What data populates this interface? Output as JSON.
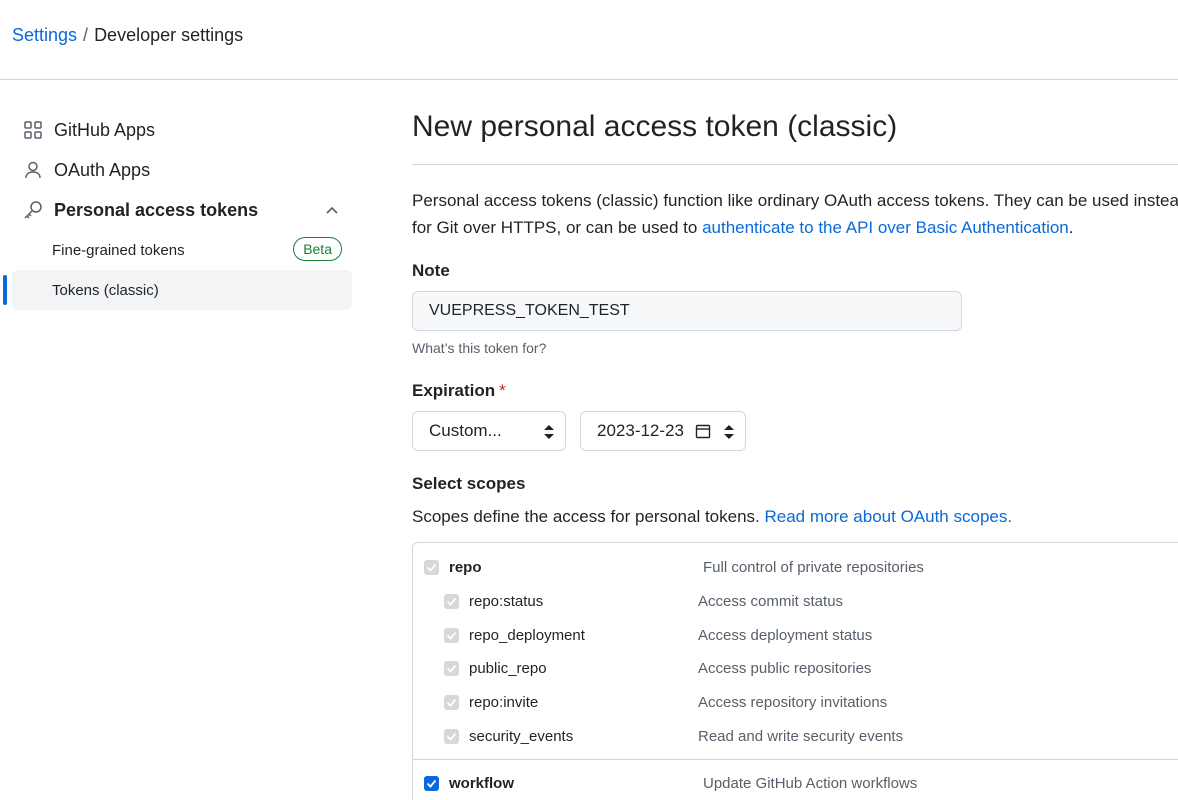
{
  "breadcrumb": {
    "root": "Settings",
    "separator": "/",
    "current": "Developer settings"
  },
  "sidebar": {
    "items": [
      {
        "label": "GitHub Apps",
        "icon": "apps-grid-icon"
      },
      {
        "label": "OAuth Apps",
        "icon": "person-icon"
      },
      {
        "label": "Personal access tokens",
        "icon": "key-icon"
      }
    ],
    "subitems": [
      {
        "label": "Fine-grained tokens",
        "badge": "Beta"
      },
      {
        "label": "Tokens (classic)"
      }
    ]
  },
  "main": {
    "title": "New personal access token (classic)",
    "description_line1": "Personal access tokens (classic) function like ordinary OAuth access tokens. They can be used instea",
    "description_line2_prefix": "for Git over HTTPS, or can be used to ",
    "description_link": "authenticate to the API over Basic Authentication",
    "description_line2_suffix": ".",
    "note_label": "Note",
    "note_value": "VUEPRESS_TOKEN_TEST",
    "note_hint": "What’s this token for?",
    "expiration_label": "Expiration",
    "expiration_required": "*",
    "expiration_select": "Custom...",
    "expiration_date": "2023-12-23",
    "scopes_label": "Select scopes",
    "scopes_desc_prefix": "Scopes define the access for personal tokens. ",
    "scopes_desc_link": "Read more about OAuth scopes."
  },
  "scopes": [
    {
      "name": "repo",
      "desc": "Full control of private repositories",
      "parent": true,
      "state": "disabled"
    },
    {
      "name": "repo:status",
      "desc": "Access commit status",
      "parent": false,
      "state": "disabled"
    },
    {
      "name": "repo_deployment",
      "desc": "Access deployment status",
      "parent": false,
      "state": "disabled"
    },
    {
      "name": "public_repo",
      "desc": "Access public repositories",
      "parent": false,
      "state": "disabled"
    },
    {
      "name": "repo:invite",
      "desc": "Access repository invitations",
      "parent": false,
      "state": "disabled"
    },
    {
      "name": "security_events",
      "desc": "Read and write security events",
      "parent": false,
      "state": "disabled"
    },
    {
      "name": "workflow",
      "desc": "Update GitHub Action workflows",
      "parent": true,
      "state": "checked"
    }
  ],
  "colors": {
    "link": "#0969da",
    "success": "#1a7f37",
    "danger": "#cf222e",
    "border": "#d0d7de"
  }
}
